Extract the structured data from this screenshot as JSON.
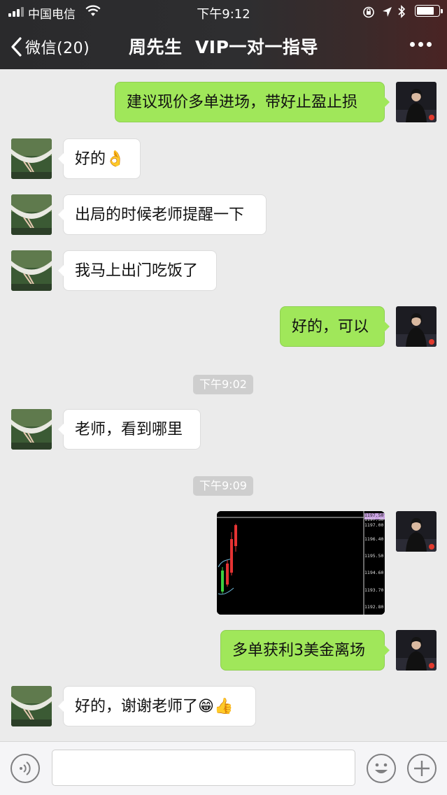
{
  "status_bar": {
    "carrier": "中国电信",
    "time": "下午9:12"
  },
  "nav": {
    "back_label": "微信(20)",
    "title": "周先生  VIP一对一指导"
  },
  "messages": [
    {
      "side": "right",
      "text": "建议现价多单进场，带好止盈止损"
    },
    {
      "side": "left",
      "text": "好的",
      "emoji": "👌"
    },
    {
      "side": "left",
      "text": "出局的时候老师提醒一下"
    },
    {
      "side": "left",
      "text": "我马上出门吃饭了"
    },
    {
      "side": "right",
      "text": "好的，可以"
    },
    {
      "type": "timestamp",
      "text": "下午9:02"
    },
    {
      "side": "left",
      "text": "老师，看到哪里"
    },
    {
      "type": "timestamp",
      "text": "下午9:09"
    },
    {
      "side": "right",
      "type": "image",
      "prices": [
        "1197.50",
        "1197.30",
        "1197.00",
        "1196.40",
        "1195.50",
        "1194.60",
        "1193.70",
        "1192.80"
      ]
    },
    {
      "side": "right",
      "text": "多单获利3美金离场"
    },
    {
      "side": "left",
      "text": "好的，谢谢老师了",
      "emoji": "😁👍"
    }
  ],
  "input_bar": {
    "voice_icon": "voice-icon",
    "emoji_icon": "emoji-face-icon",
    "plus_icon": "plus-icon",
    "text": ""
  },
  "colors": {
    "bubble_right": "#a0e75a",
    "bubble_left": "#ffffff",
    "chat_bg": "#ebebeb"
  }
}
